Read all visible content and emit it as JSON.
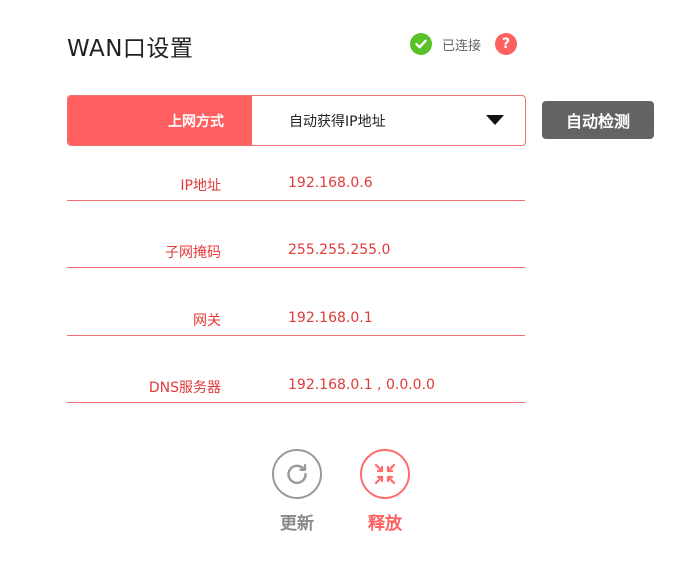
{
  "title": "WAN口设置",
  "status": {
    "icon": "check-circle-icon",
    "label": "已连接",
    "help_glyph": "?",
    "colors": {
      "ok": "#5ac229",
      "help": "#ff6060"
    }
  },
  "connection": {
    "label": "上网方式",
    "selected": "自动获得IP地址",
    "detect_button": "自动检测"
  },
  "info": [
    {
      "label": "IP地址",
      "value": "192.168.0.6"
    },
    {
      "label": "子网掩码",
      "value": "255.255.255.0"
    },
    {
      "label": "网关",
      "value": "192.168.0.1"
    },
    {
      "label": "DNS服务器",
      "value": "192.168.0.1 , 0.0.0.0"
    }
  ],
  "actions": {
    "refresh": {
      "label": "更新",
      "icon": "refresh-icon"
    },
    "release": {
      "label": "释放",
      "icon": "collapse-arrows-icon"
    }
  },
  "colors": {
    "accent": "#ff5f5f",
    "text_red": "#e03a3a",
    "button_gray": "#636363"
  }
}
